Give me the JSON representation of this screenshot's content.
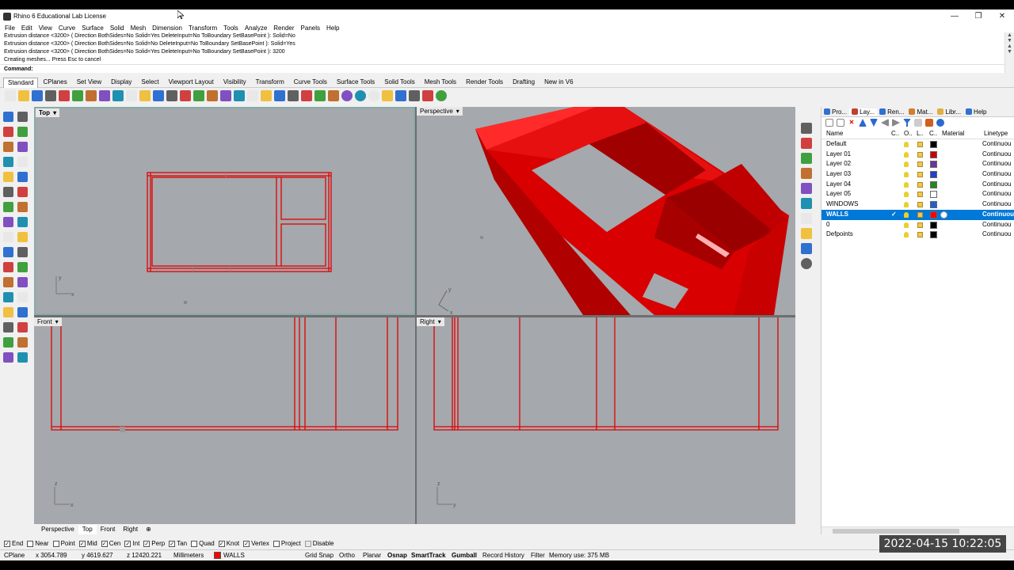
{
  "window": {
    "title": "Rhino 6 Educational Lab License",
    "min": "—",
    "restore": "❐",
    "close": "✕"
  },
  "menu": [
    "File",
    "Edit",
    "View",
    "Curve",
    "Surface",
    "Solid",
    "Mesh",
    "Dimension",
    "Transform",
    "Tools",
    "Analyze",
    "Render",
    "Panels",
    "Help"
  ],
  "history": [
    "Extrusion distance <3200> ( Direction  BothSides=No  Solid=Yes  DeleteInput=No  ToBoundary  SetBasePoint ): Solid=No",
    "Extrusion distance <3200> ( Direction  BothSides=No  Solid=No  DeleteInput=No  ToBoundary  SetBasePoint ): Solid=Yes",
    "Extrusion distance <3200> ( Direction  BothSides=No  Solid=Yes  DeleteInput=No  ToBoundary  SetBasePoint ): 3200",
    "Creating meshes... Press Esc to cancel"
  ],
  "command": {
    "label": "Command:",
    "value": ""
  },
  "toolbar_tabs": [
    "Standard",
    "CPlanes",
    "Set View",
    "Display",
    "Select",
    "Viewport Layout",
    "Visibility",
    "Transform",
    "Curve Tools",
    "Surface Tools",
    "Solid Tools",
    "Mesh Tools",
    "Render Tools",
    "Drafting",
    "New in V6"
  ],
  "toolbar_icons": [
    "new-icon",
    "open-icon",
    "save-icon",
    "print-icon",
    "import-icon",
    "cut-icon",
    "copy-icon",
    "paste-icon",
    "undo-icon",
    "pan-icon",
    "rotate-view-icon",
    "zoom-dynamic-icon",
    "zoom-window-icon",
    "zoom-extents-icon",
    "zoom-selected-icon",
    "rotate-icon",
    "four-views-icon",
    "plan-view-icon",
    "car-icon",
    "properties-icon",
    "osnap-icon",
    "hide-icon",
    "lights-icon",
    "lock-icon",
    "surface-icon",
    "color-wheel-icon",
    "shaded-icon",
    "render-sphere-icon",
    "material-icon",
    "move-icon",
    "gumball-icon",
    "history-icon",
    "help-icon"
  ],
  "viewports": {
    "top": {
      "label": "Top",
      "axis_x": "x",
      "axis_y": "y"
    },
    "perspective": {
      "label": "Perspective",
      "axis_x": "x",
      "axis_y": "y"
    },
    "front": {
      "label": "Front",
      "axis_x": "x",
      "axis_y": "z"
    },
    "right": {
      "label": "Right",
      "axis_x": "y",
      "axis_y": "z"
    }
  },
  "viewport_tabs": [
    "Perspective",
    "Top",
    "Front",
    "Right"
  ],
  "panel": {
    "tabs": [
      "Pro...",
      "Lay...",
      "Ren...",
      "Mat...",
      "Libr...",
      "Help"
    ],
    "columns": {
      "name": "Name",
      "material": "Material",
      "linetype": "Linetype"
    },
    "layers": [
      {
        "name": "Default",
        "color": "#000000",
        "linetype": "Continuou",
        "current": false,
        "selected": false
      },
      {
        "name": "Layer 01",
        "color": "#cc0000",
        "linetype": "Continuou",
        "current": false,
        "selected": false
      },
      {
        "name": "Layer 02",
        "color": "#7030a0",
        "linetype": "Continuou",
        "current": false,
        "selected": false
      },
      {
        "name": "Layer 03",
        "color": "#1f3fd0",
        "linetype": "Continuou",
        "current": false,
        "selected": false
      },
      {
        "name": "Layer 04",
        "color": "#1f8a1f",
        "linetype": "Continuou",
        "current": false,
        "selected": false
      },
      {
        "name": "Layer 05",
        "color": "#ffffff",
        "linetype": "Continuou",
        "current": false,
        "selected": false
      },
      {
        "name": "WINDOWS",
        "color": "#2060d0",
        "linetype": "Continuou",
        "current": false,
        "selected": false
      },
      {
        "name": "WALLS",
        "color": "#ff0000",
        "linetype": "Continuou",
        "current": true,
        "selected": true
      },
      {
        "name": "0",
        "color": "#000000",
        "linetype": "Continuou",
        "current": false,
        "selected": false
      },
      {
        "name": "Defpoints",
        "color": "#000000",
        "linetype": "Continuou",
        "current": false,
        "selected": false
      }
    ]
  },
  "osnap": [
    {
      "label": "End",
      "checked": true
    },
    {
      "label": "Near",
      "checked": false
    },
    {
      "label": "Point",
      "checked": false
    },
    {
      "label": "Mid",
      "checked": true
    },
    {
      "label": "Cen",
      "checked": true
    },
    {
      "label": "Int",
      "checked": true
    },
    {
      "label": "Perp",
      "checked": true
    },
    {
      "label": "Tan",
      "checked": true
    },
    {
      "label": "Quad",
      "checked": false
    },
    {
      "label": "Knot",
      "checked": true
    },
    {
      "label": "Vertex",
      "checked": true
    },
    {
      "label": "Project",
      "checked": false
    },
    {
      "label": "Disable",
      "checked": false
    }
  ],
  "status": {
    "cplane": "CPlane",
    "x": "x 3054.789",
    "y": "y 4619.627",
    "z": "z 12420.221",
    "units": "Millimeters",
    "layer": "WALLS",
    "layer_color": "#ff0000",
    "grid_snap": "Grid Snap",
    "ortho": "Ortho",
    "planar": "Planar",
    "osnap": "Osnap",
    "smarttrack": "SmartTrack",
    "gumball": "Gumball",
    "record_history": "Record History",
    "filter": "Filter",
    "memory": "Memory use: 375 MB"
  },
  "timestamp": "2022-04-15  10:22:05",
  "colors": {
    "geometry": "#ff0000",
    "viewport_bg": "#a5a8ac",
    "selection": "#0078d7"
  }
}
